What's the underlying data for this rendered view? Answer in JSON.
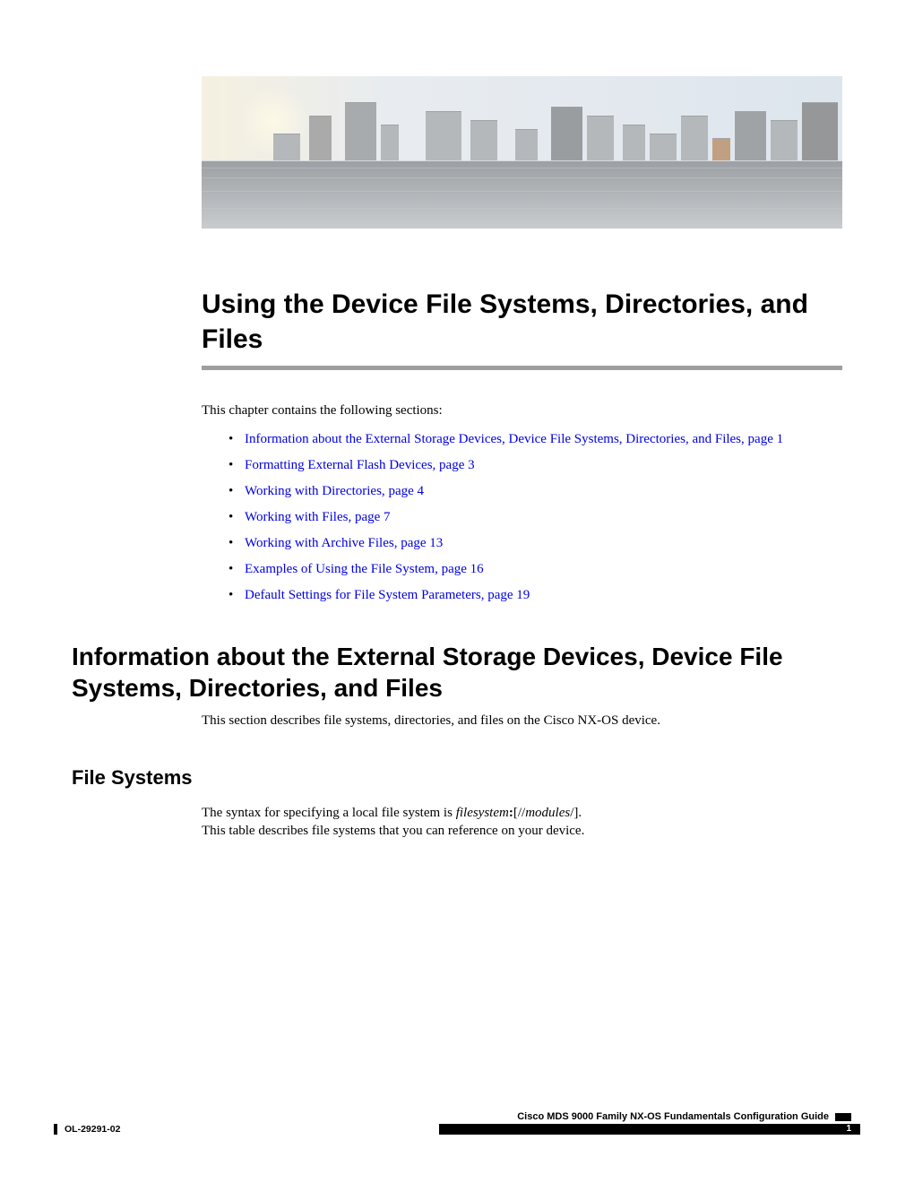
{
  "title": "Using the Device File Systems, Directories, and Files",
  "intro": "This chapter contains the following sections:",
  "toc": [
    {
      "text": "Information about the External Storage Devices, Device File Systems, Directories, and Files,",
      "page": "page  1"
    },
    {
      "text": "Formatting External Flash Devices,",
      "page": "page  3"
    },
    {
      "text": "Working with Directories,",
      "page": "page  4"
    },
    {
      "text": "Working with Files,",
      "page": "page  7"
    },
    {
      "text": "Working with Archive Files,",
      "page": "page  13"
    },
    {
      "text": "Examples of Using the File System,",
      "page": "page  16"
    },
    {
      "text": "Default Settings for File System Parameters,",
      "page": "page  19"
    }
  ],
  "section1": {
    "heading": "Information about the External Storage Devices, Device File Systems, Directories, and Files",
    "body": "This section describes file systems, directories, and files on the Cisco NX-OS device."
  },
  "sub1": {
    "heading": "File Systems",
    "line1_prefix": "The syntax for specifying a local file system is ",
    "line1_italic1": "filesystem",
    "line1_bold": ":",
    "line1_mid": "[//",
    "line1_italic2": "modules",
    "line1_suffix": "/].",
    "line2": "This table describes file systems that you can reference on your device."
  },
  "footer": {
    "guide": "Cisco MDS 9000 Family NX-OS Fundamentals Configuration Guide",
    "docid": "OL-29291-02",
    "page": "1"
  }
}
